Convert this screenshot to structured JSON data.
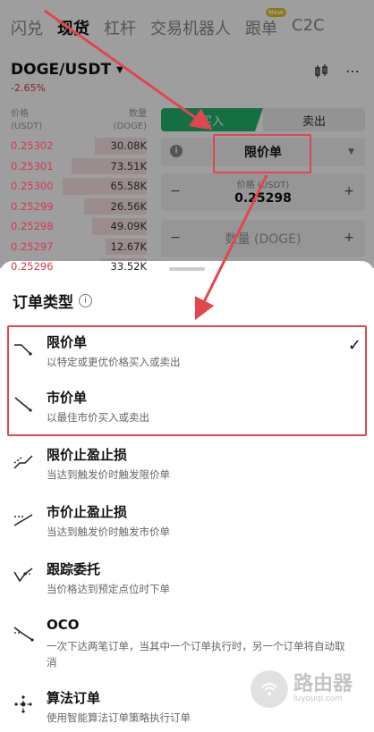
{
  "tabs": [
    {
      "label": "闪兑",
      "active": false
    },
    {
      "label": "现货",
      "active": true
    },
    {
      "label": "杠杆",
      "active": false
    },
    {
      "label": "交易机器人",
      "active": false
    },
    {
      "label": "跟单",
      "active": false,
      "badge": "New"
    },
    {
      "label": "C2C",
      "active": false
    }
  ],
  "pair": {
    "symbol": "DOGE/USDT",
    "change": "-2.65%"
  },
  "orderbook": {
    "price_header": "价格",
    "price_unit": "(USDT)",
    "qty_header": "数量",
    "qty_unit": "(DOGE)",
    "rows": [
      {
        "price": "0.25302",
        "qty": "30.08K"
      },
      {
        "price": "0.25301",
        "qty": "73.51K"
      },
      {
        "price": "0.25300",
        "qty": "65.58K"
      },
      {
        "price": "0.25299",
        "qty": "26.56K"
      },
      {
        "price": "0.25298",
        "qty": "49.09K"
      },
      {
        "price": "0.25297",
        "qty": "12.67K"
      },
      {
        "price": "0.25296",
        "qty": "33.52K"
      }
    ]
  },
  "form": {
    "buy_label": "买入",
    "sell_label": "卖出",
    "order_type": "限价单",
    "price_label": "价格 (USDT)",
    "price_value": "0.25298",
    "qty_placeholder": "数量 (DOGE)"
  },
  "sheet": {
    "title": "订单类型",
    "options": [
      {
        "name": "限价单",
        "desc": "以特定或更优价格买入或卖出",
        "selected": true
      },
      {
        "name": "市价单",
        "desc": "以最佳市价买入或卖出",
        "selected": false
      },
      {
        "name": "限价止盈止损",
        "desc": "当达到触发价时触发限价单",
        "selected": false
      },
      {
        "name": "市价止盈止损",
        "desc": "当达到触发价时触发市价单",
        "selected": false
      },
      {
        "name": "跟踪委托",
        "desc": "当价格达到预定点位时下单",
        "selected": false
      },
      {
        "name": "OCO",
        "desc": "一次下达两笔订单，当其中一个订单执行时，另一个订单将自动取消",
        "selected": false
      },
      {
        "name": "算法订单",
        "desc": "使用智能算法订单策略执行订单",
        "selected": false
      }
    ]
  },
  "watermark": {
    "title": "路由器",
    "sub": "luyouqi.com"
  },
  "colors": {
    "accent_red": "#d23a4b",
    "buy_green": "#21b46d",
    "annotation_red": "#e0474f"
  }
}
